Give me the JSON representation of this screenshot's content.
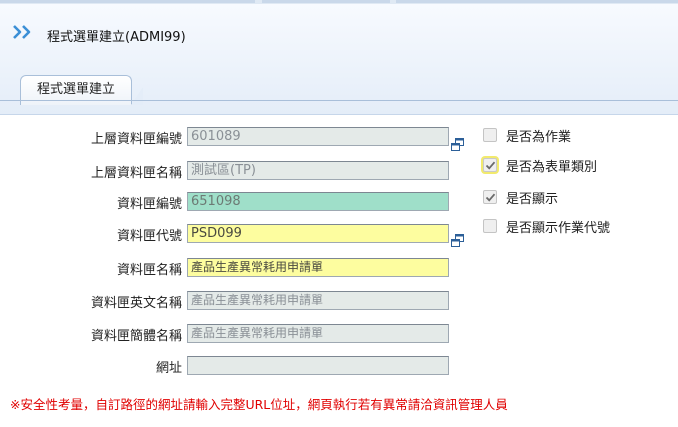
{
  "header": {
    "title": "程式選單建立(ADMI99)"
  },
  "tab": {
    "label": "程式選單建立"
  },
  "form": {
    "parent_id": {
      "label": "上層資料匣編號",
      "value": "601089"
    },
    "parent_name": {
      "label": "上層資料匣名稱",
      "value": "測試區(TP)"
    },
    "folder_id": {
      "label": "資料匣編號",
      "value": "651098"
    },
    "folder_code": {
      "label": "資料匣代號",
      "value": "PSD099"
    },
    "folder_name": {
      "label": "資料匣名稱",
      "value": "產品生產異常耗用申請單"
    },
    "folder_name_en": {
      "label": "資料匣英文名稱",
      "value": "產品生產異常耗用申請單"
    },
    "folder_name_short": {
      "label": "資料匣簡體名稱",
      "value": "產品生產異常耗用申請單"
    },
    "url": {
      "label": "網址",
      "value": ""
    }
  },
  "options": [
    {
      "label": "是否為作業",
      "checked": false
    },
    {
      "label": "是否為表單類別",
      "checked": true
    },
    {
      "label": "是否顯示",
      "checked": true
    },
    {
      "label": "是否顯示作業代號",
      "checked": false
    }
  ],
  "note": "※安全性考量，自訂路徑的網址請輸入完整URL位址，網頁執行若有異常請洽資訊管理人員",
  "colors": {
    "required": "#fdfd9f",
    "key": "#9fdfc9",
    "readonly": "#e4eae8",
    "warning": "#e00000"
  }
}
